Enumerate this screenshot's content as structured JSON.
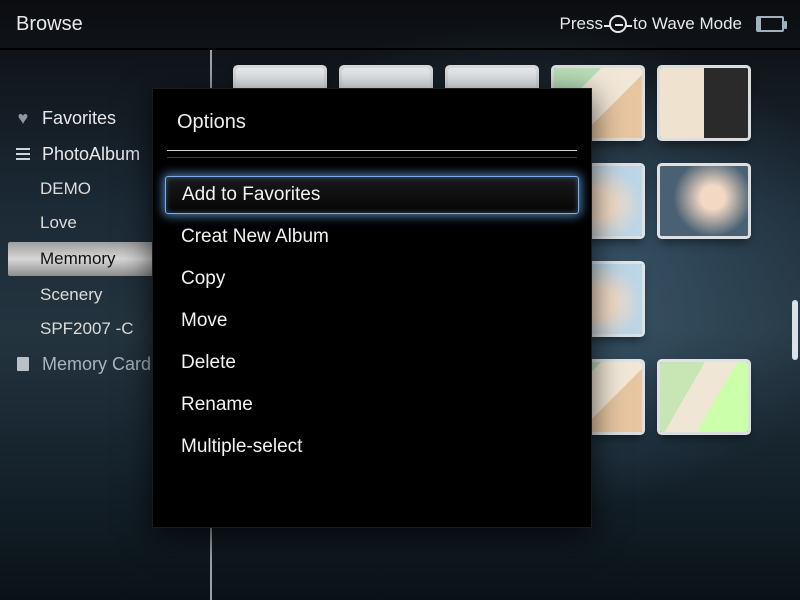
{
  "topbar": {
    "title": "Browse",
    "hint_prefix": "Press",
    "hint_suffix": "to Wave Mode"
  },
  "sidebar": {
    "favorites_label": "Favorites",
    "photoalbum_label": "PhotoAlbum",
    "albums": [
      {
        "label": "DEMO"
      },
      {
        "label": "Love"
      },
      {
        "label": "Memmory"
      },
      {
        "label": "Scenery"
      },
      {
        "label": "SPF2007 -C"
      }
    ],
    "memorycard_label": "Memory Card"
  },
  "popup": {
    "title": "Options",
    "items": [
      {
        "label": "Add to Favorites"
      },
      {
        "label": "Creat New Album"
      },
      {
        "label": "Copy"
      },
      {
        "label": "Move"
      },
      {
        "label": "Delete"
      },
      {
        "label": "Rename"
      },
      {
        "label": "Multiple-select"
      }
    ],
    "highlight_index": 0
  },
  "colors": {
    "highlight_glow": "#77aef0"
  }
}
